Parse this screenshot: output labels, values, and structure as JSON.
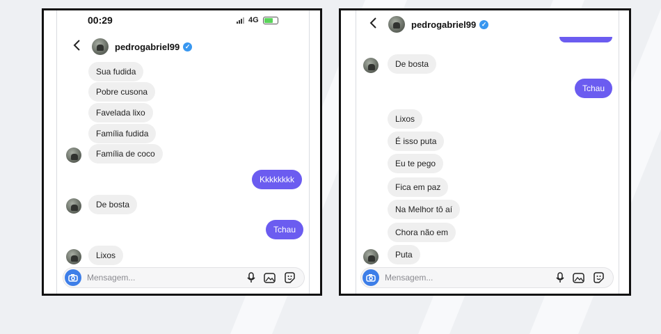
{
  "left_screenshot": {
    "status_bar": {
      "time": "00:29",
      "network": "4G"
    },
    "header": {
      "username": "pedrogabriel99"
    },
    "messages": [
      {
        "text": "Sua fudida"
      },
      {
        "text": "Pobre cusona"
      },
      {
        "text": "Favelada lixo"
      },
      {
        "text": "Família fudida"
      },
      {
        "text": "Família de coco"
      },
      {
        "text": "Kkkkkkkk"
      },
      {
        "text": "De bosta"
      },
      {
        "text": "Tchau"
      },
      {
        "text": "Lixos"
      }
    ],
    "input": {
      "placeholder": "Mensagem..."
    }
  },
  "right_screenshot": {
    "header": {
      "username": "pedrogabriel99"
    },
    "messages": [
      {
        "text": "De bosta"
      },
      {
        "text": "Tchau"
      },
      {
        "text": "Lixos"
      },
      {
        "text": "É isso puta"
      },
      {
        "text": "Eu te pego"
      },
      {
        "text": "Fica em paz"
      },
      {
        "text": "Na Melhor tô aí"
      },
      {
        "text": "Chora não em"
      },
      {
        "text": "Puta"
      }
    ],
    "input": {
      "placeholder": "Mensagem..."
    }
  },
  "colors": {
    "sent_bubble": "#6b5cf0",
    "received_bubble": "#efefef",
    "verified_badge": "#3897f0",
    "camera_button": "#3d7ee8"
  }
}
